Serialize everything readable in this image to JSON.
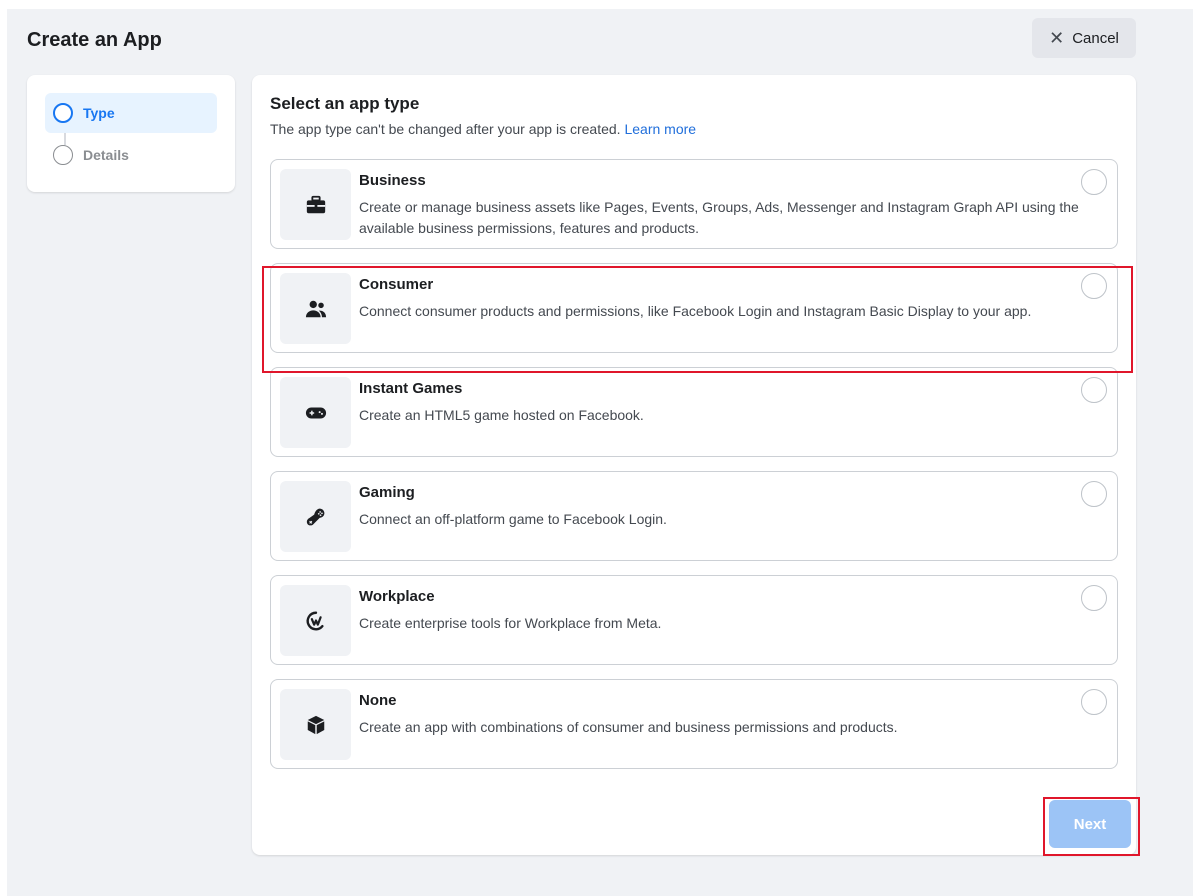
{
  "header": {
    "title": "Create an App",
    "cancel_label": "Cancel",
    "cancel_icon": "close-icon"
  },
  "stepper": {
    "steps": [
      {
        "label": "Type",
        "state": "active"
      },
      {
        "label": "Details",
        "state": "inactive"
      }
    ]
  },
  "panel": {
    "title": "Select an app type",
    "subtitle": "The app type can't be changed after your app is created.",
    "learn_more": "Learn more"
  },
  "options": [
    {
      "title": "Business",
      "description": "Create or manage business assets like Pages, Events, Groups, Ads, Messenger and Instagram Graph API using the available business permissions, features and products.",
      "icon": "briefcase-icon"
    },
    {
      "title": "Consumer",
      "description": "Connect consumer products and permissions, like Facebook Login and Instagram Basic Display to your app.",
      "icon": "people-icon"
    },
    {
      "title": "Instant Games",
      "description": "Create an HTML5 game hosted on Facebook.",
      "icon": "game-controller-icon"
    },
    {
      "title": "Gaming",
      "description": "Connect an off-platform game to Facebook Login.",
      "icon": "gamepad-icon"
    },
    {
      "title": "Workplace",
      "description": "Create enterprise tools for Workplace from Meta.",
      "icon": "workplace-icon"
    },
    {
      "title": "None",
      "description": "Create an app with combinations of consumer and business permissions and products.",
      "icon": "cube-icon"
    }
  ],
  "footer": {
    "next_label": "Next"
  },
  "colors": {
    "accent": "#1877f2",
    "next_disabled": "#9cc4f6",
    "highlight": "#e0162b",
    "background": "#f0f2f5"
  }
}
